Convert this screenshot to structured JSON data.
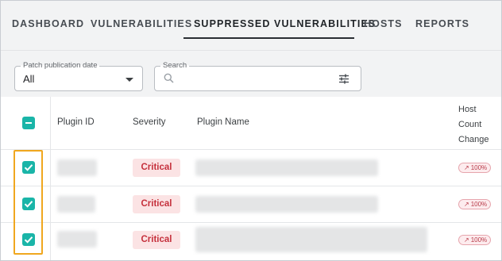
{
  "nav": {
    "tabs": [
      {
        "label": "DASHBOARD"
      },
      {
        "label": "VULNERABILITIES"
      },
      {
        "label": "SUPPRESSED VULNERABILITIES"
      },
      {
        "label": "HOSTS"
      },
      {
        "label": "REPORTS"
      }
    ],
    "active_tab": "SUPPRESSED VULNERABILITIES"
  },
  "filters": {
    "patch_date": {
      "label": "Patch publication date",
      "value": "All"
    },
    "search": {
      "label": "Search",
      "placeholder": ""
    }
  },
  "table": {
    "columns": {
      "plugin_id": "Plugin ID",
      "severity": "Severity",
      "plugin_name": "Plugin Name",
      "host_count_change": [
        "Host",
        "Count",
        "Change"
      ]
    },
    "header_checkbox": "indeterminate",
    "rows": [
      {
        "selected": true,
        "severity": "Critical",
        "change": "100%"
      },
      {
        "selected": true,
        "severity": "Critical",
        "change": "100%"
      },
      {
        "selected": true,
        "severity": "Critical",
        "change": "100%"
      }
    ]
  },
  "colors": {
    "accent": "#1ab5a8",
    "critical_text": "#c5303c",
    "critical_bg": "#fbe3e4",
    "highlight_box": "#f0a71f"
  },
  "icons": {
    "search": "search-icon",
    "filter": "filter-sliders-icon",
    "dropdown": "chevron-down-icon",
    "trend": "arrow-up-right-icon"
  }
}
